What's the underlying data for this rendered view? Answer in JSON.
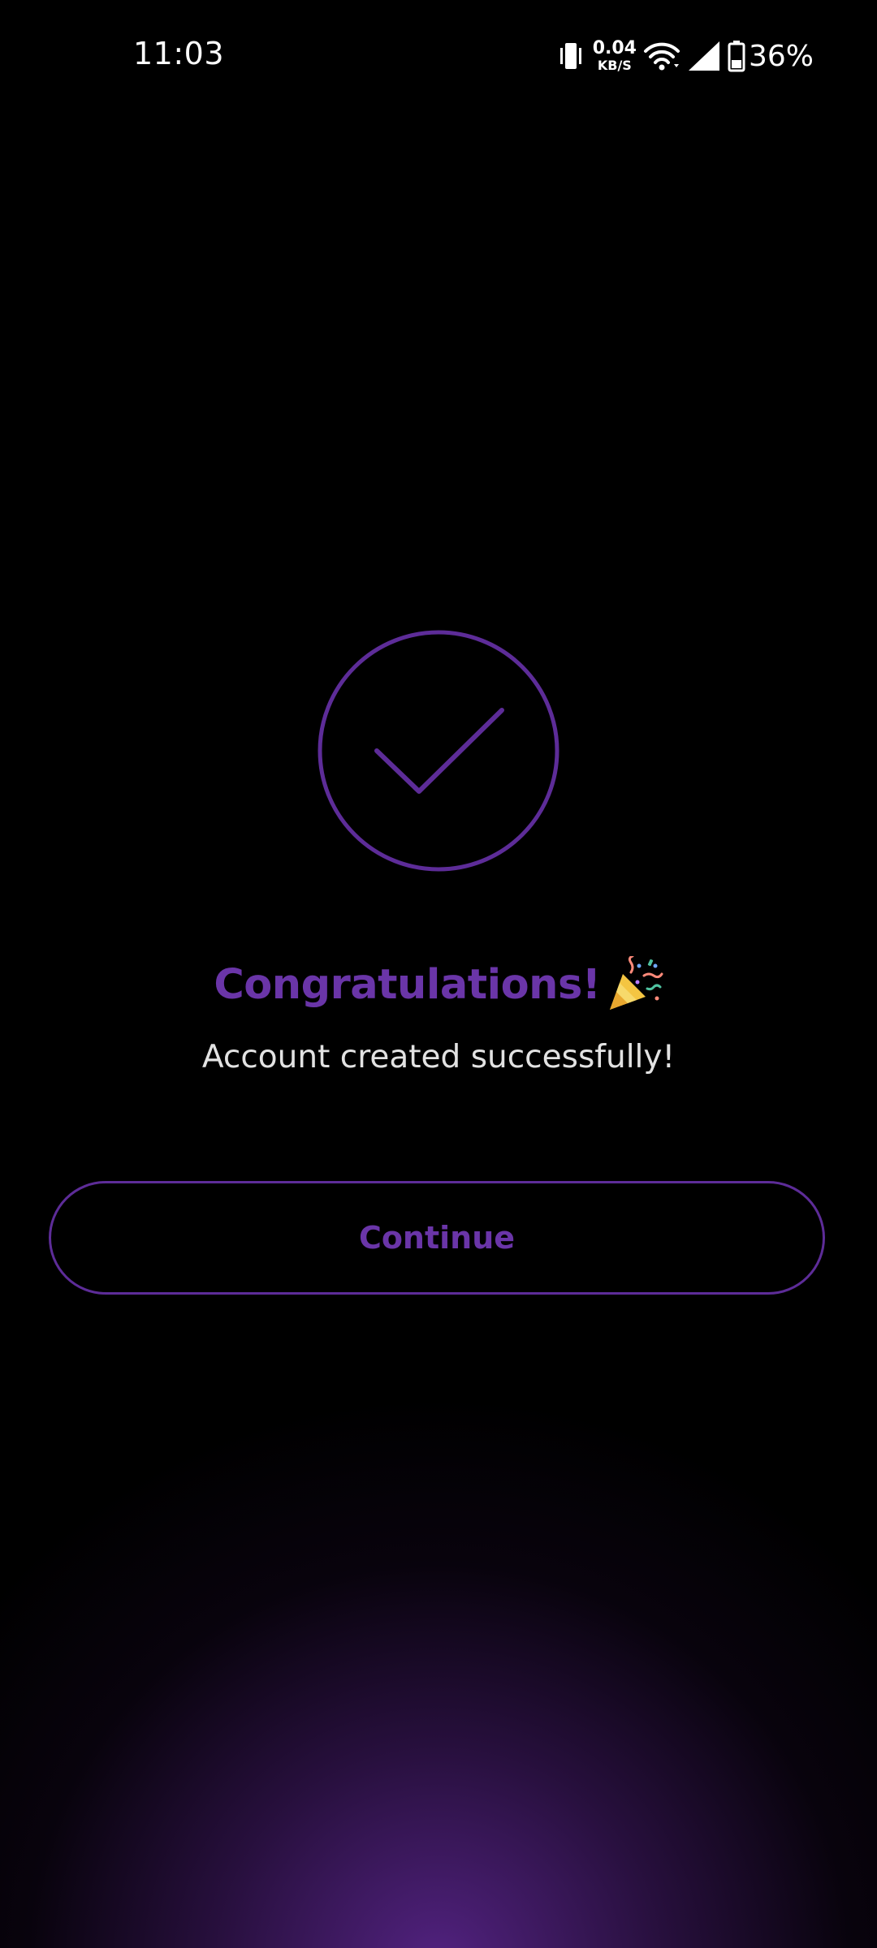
{
  "status_bar": {
    "time": "11:03",
    "net_speed_value": "0.04",
    "net_speed_unit": "KB/S",
    "battery_percent": "36%",
    "icons": [
      "vibrate-icon",
      "wifi-icon",
      "signal-icon",
      "battery-icon"
    ]
  },
  "success": {
    "icon": "check-circle-icon",
    "title": "Congratulations!",
    "title_emoji": "party-popper-icon",
    "message": "Account created successfully!"
  },
  "actions": {
    "continue_label": "Continue"
  },
  "colors": {
    "accent": "#6a35a8",
    "background": "#000000",
    "glow": "#5a2a8c",
    "text_secondary": "#e2e2e2"
  }
}
